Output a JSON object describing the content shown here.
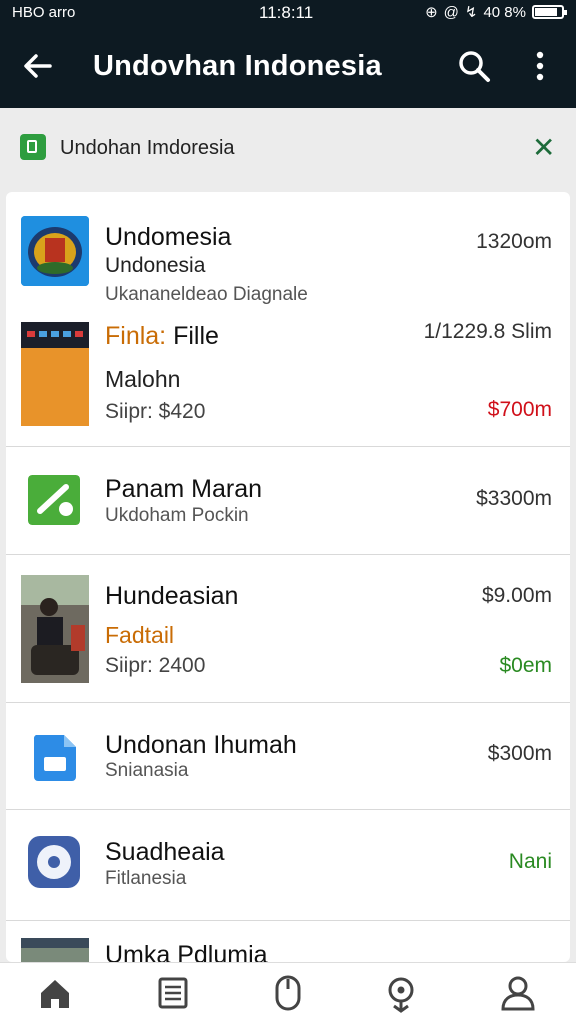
{
  "status_bar": {
    "carrier": "HBO arro",
    "time": "11:8:11",
    "battery": "40 8%"
  },
  "app_bar": {
    "title": "Undovhan Indonesia"
  },
  "filter": {
    "label": "Undohan Imdoresia"
  },
  "items": [
    {
      "title": "Undomesia",
      "subtitle": "Undonesia",
      "detail": "Ukananeldeao   Diagnale",
      "price": "1320om"
    },
    {
      "title_prefix": "Finla:",
      "title_rest": " Fille",
      "subtitle": "Malohn",
      "detail": "Siipr: $420",
      "price_top": "1/1229.8 Slim",
      "price": "$700m"
    },
    {
      "title": "Panam Maran",
      "subtitle": "Ukdoham Pockin",
      "price": "$3300m"
    },
    {
      "title": "Hundeasian",
      "subtitle": "Fadtail",
      "detail": "Siipr: 2400",
      "price_top": "$9.00m",
      "price": "$0em"
    },
    {
      "title": "Undonan Ihumah",
      "subtitle": "Snianasia",
      "price": "$300m"
    },
    {
      "title": "Suadheaia",
      "subtitle": "Fitlanesia",
      "price": "Nani"
    },
    {
      "title": "Umka Pdlumia"
    }
  ],
  "colors": {
    "app_bar": "#0d1a22",
    "price_red": "#d0101a",
    "price_green": "#2a8a22",
    "accent_orange": "#c96c05"
  },
  "nav": [
    "home-icon",
    "list-icon",
    "mouse-icon",
    "location-icon",
    "profile-icon"
  ]
}
